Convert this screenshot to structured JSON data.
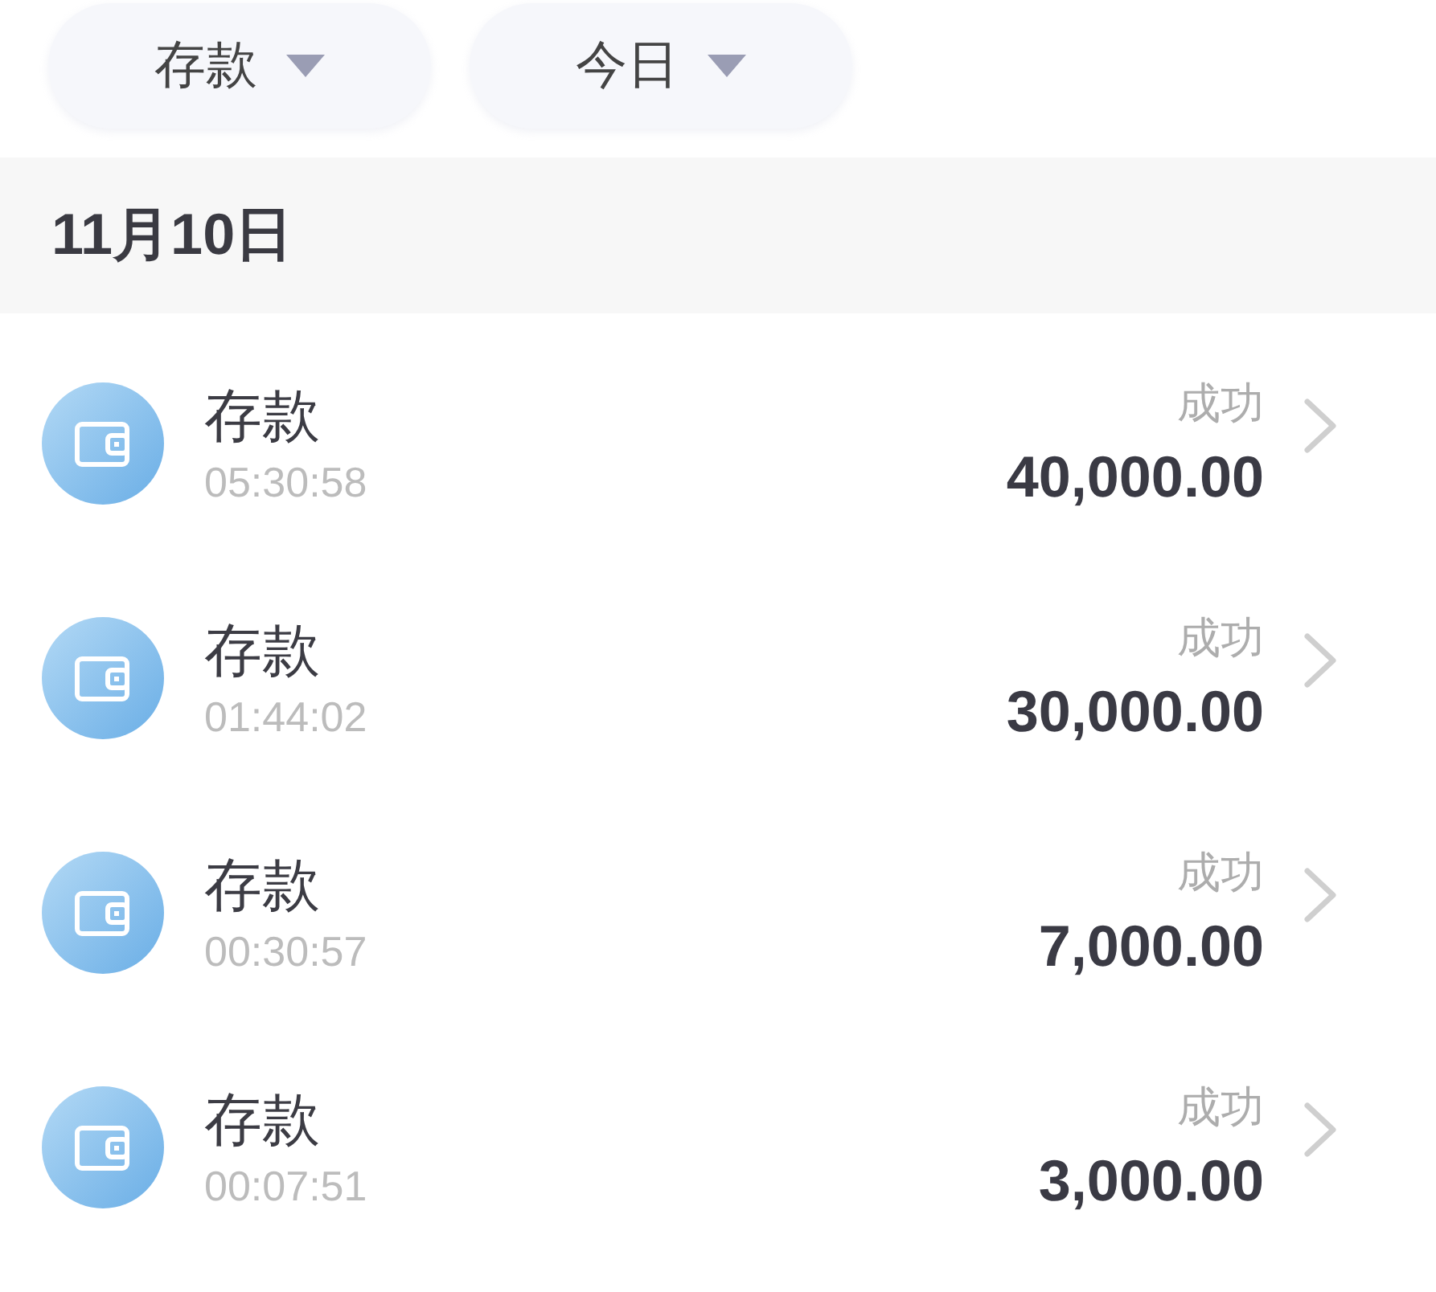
{
  "filters": [
    {
      "label": "存款"
    },
    {
      "label": "今日"
    }
  ],
  "date_header": "11月10日",
  "transactions": [
    {
      "title": "存款",
      "time": "05:30:58",
      "status": "成功",
      "amount": "40,000.00"
    },
    {
      "title": "存款",
      "time": "01:44:02",
      "status": "成功",
      "amount": "30,000.00"
    },
    {
      "title": "存款",
      "time": "00:30:57",
      "status": "成功",
      "amount": "7,000.00"
    },
    {
      "title": "存款",
      "time": "00:07:51",
      "status": "成功",
      "amount": "3,000.00"
    }
  ]
}
